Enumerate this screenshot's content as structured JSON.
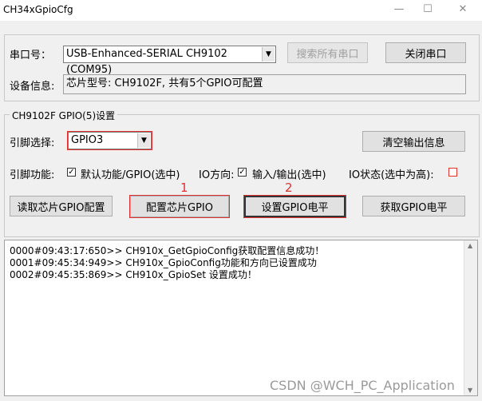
{
  "window": {
    "title": "CH34xGpioCfg",
    "minimize": "—",
    "maximize": "☐",
    "close": "✕"
  },
  "port": {
    "label": "串口号：",
    "selected": "USB-Enhanced-SERIAL CH9102 (COM95)",
    "search_button": "搜索所有串口",
    "close_button": "关闭串口"
  },
  "device": {
    "label": "设备信息:",
    "value": "芯片型号: CH9102F, 共有5个GPIO可配置"
  },
  "gpio_group": {
    "title": "CH9102F GPIO(5)设置",
    "pin_select_label": "引脚选择:",
    "pin_selected": "GPIO3",
    "clear_output_button": "清空输出信息",
    "pin_func_label": "引脚功能:",
    "default_func_check": "✓",
    "default_func_label": "默认功能/GPIO(选中)",
    "io_dir_label": "IO方向:",
    "io_dir_check": "✓",
    "io_dir_value": "输入/输出(选中)",
    "io_state_label": "IO状态(选中为高):",
    "read_config_button": "读取芯片GPIO配置",
    "config_button": "配置芯片GPIO",
    "set_level_button": "设置GPIO电平",
    "get_level_button": "获取GPIO电平",
    "annotation_1": "1",
    "annotation_2": "2"
  },
  "log": {
    "lines": [
      "0000#09:43:17:650>> CH910x_GetGpioConfig获取配置信息成功！",
      "0001#09:45:34:949>> CH910x_GpioConfig功能和方向已设置成功",
      "0002#09:45:35:869>> CH910x_GpioSet 设置成功！"
    ]
  },
  "watermark": "CSDN @WCH_PC_Application"
}
